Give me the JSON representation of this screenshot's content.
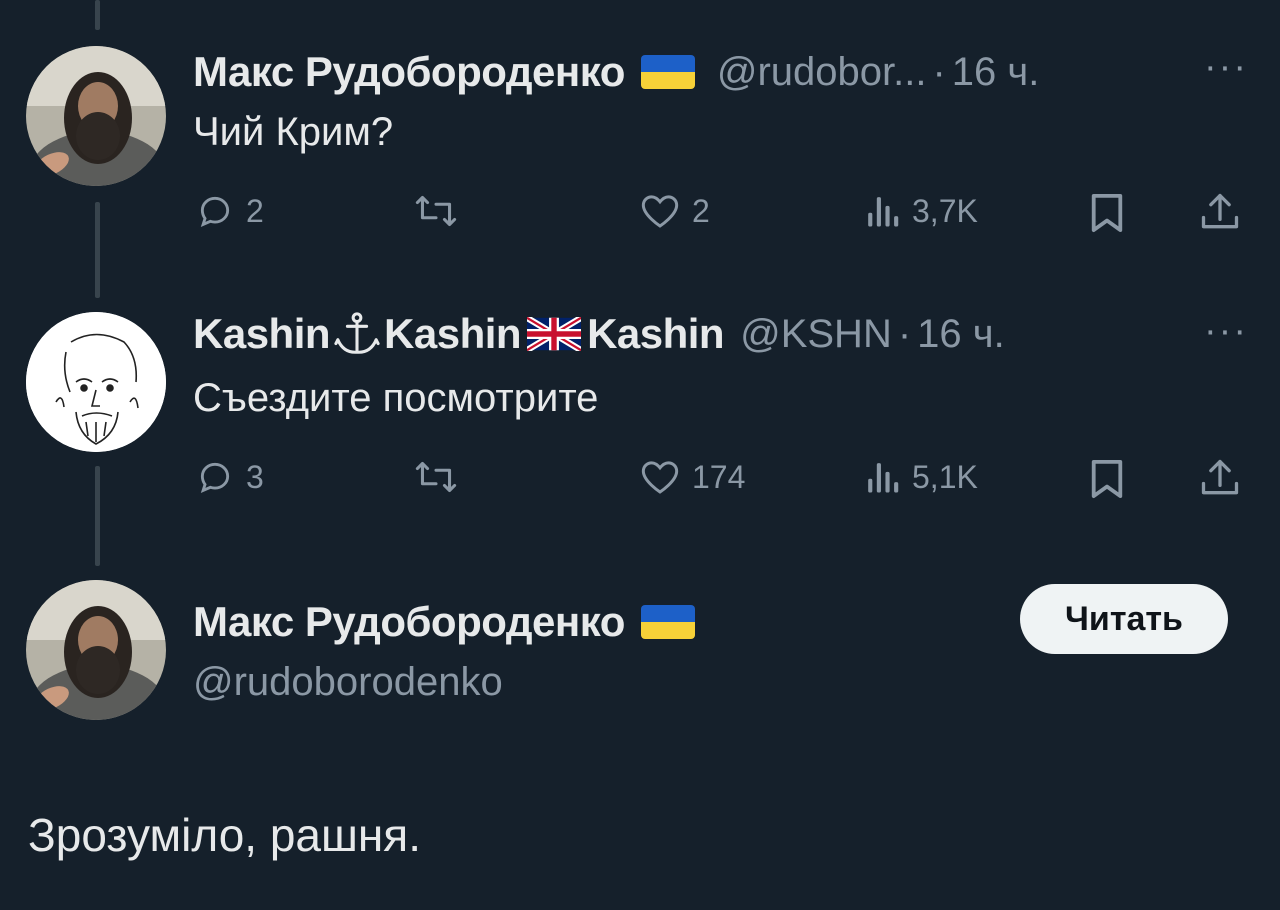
{
  "thread": [
    {
      "author_name": "Макс Рудобороденко",
      "handle": "@rudobor...",
      "time": "16 ч.",
      "text": "Чий Крим?",
      "replies": "2",
      "reposts": "",
      "likes": "2",
      "views": "3,7K",
      "more_label": "···"
    },
    {
      "author_name_parts": [
        "Kashin",
        "Kashin",
        "Kashin"
      ],
      "handle": "@KSHN",
      "time": "16 ч.",
      "text": "Съездите посмотрите",
      "replies": "3",
      "reposts": "",
      "likes": "174",
      "views": "5,1K",
      "more_label": "···"
    }
  ],
  "main_tweet": {
    "author_name": "Макс Рудобороденко",
    "handle": "@rudoborodenko",
    "follow_label": "Читать",
    "text": "Зрозуміло, рашня."
  },
  "icons": [
    "reply-icon",
    "repost-icon",
    "like-icon",
    "views-icon",
    "bookmark-icon",
    "share-icon",
    "ukraine-flag-icon",
    "anchor-icon",
    "uk-flag-icon"
  ],
  "colors": {
    "background": "#15202b",
    "text_primary": "#e7e9ea",
    "text_secondary": "#8b98a5",
    "button_bg": "#eff3f4",
    "flag_blue": "#1d60c8",
    "flag_yellow": "#f7d138"
  }
}
